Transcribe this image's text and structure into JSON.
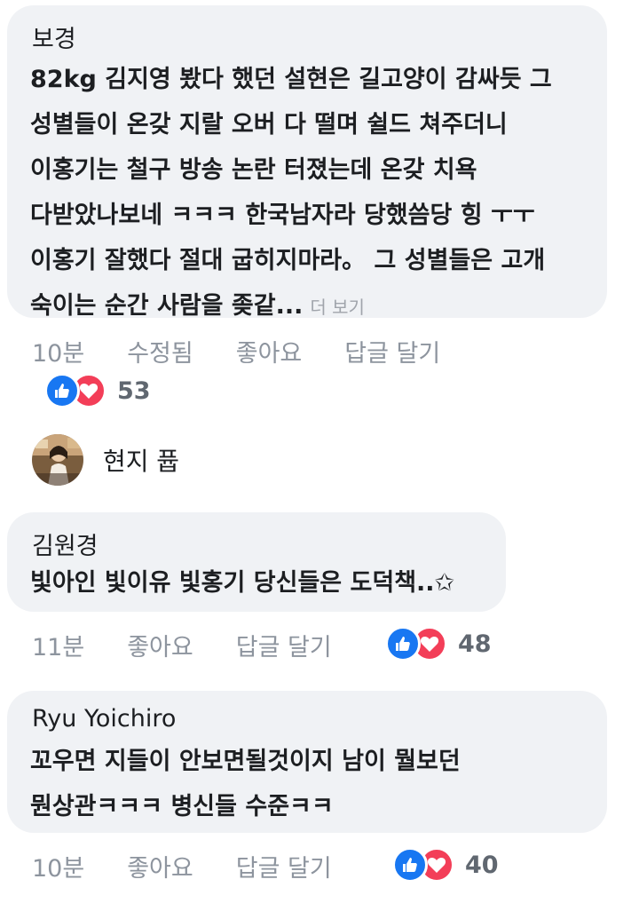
{
  "comments": [
    {
      "author": "보경",
      "lines": [
        "82kg 김지영 봤다 했던 설현은 길고양이 감싸듯 그",
        "성별들이 온갖 지랄 오버 다 떨며 쉴드 쳐주더니",
        "이홍기는 철구 방송 논란 터졌는데 온갖 치욕",
        "다받았나보네 ㅋㅋㅋ 한국남자라 당했씀당 힝 ㅜㅜ",
        "이홍기 잘했다 절대 굽히지마라。 그 성별들은 고개",
        "숙이는 순간 사람을 좆같..."
      ],
      "see_more": "더 보기",
      "time": "10분",
      "edited": "수정됨",
      "like": "좋아요",
      "reply": "답글 달기",
      "reaction_count": "53"
    },
    {
      "author": "김원경",
      "lines": [
        "빛아인 빛이유 빛홍기 당신들은 도덕책..✩"
      ],
      "time": "11분",
      "like": "좋아요",
      "reply": "답글 달기",
      "reaction_count": "48"
    },
    {
      "author": "Ryu Yoichiro",
      "lines": [
        "꼬우면 지들이 안보면될것이지 남이 뭘보던",
        "뭔상관ㅋㅋㅋ 병신들 수준ㅋㅋ"
      ],
      "time": "10분",
      "like": "좋아요",
      "reply": "답글 달기",
      "reaction_count": "40"
    }
  ],
  "reply_preview": {
    "name": "현지 퓹"
  },
  "colors": {
    "bubble": "#f0f2f5",
    "like_blue": "#1877f2",
    "love_red": "#f33e58",
    "meta_gray": "#8d949e"
  },
  "icons": {
    "like": "thumbs-up-icon",
    "love": "heart-icon"
  }
}
